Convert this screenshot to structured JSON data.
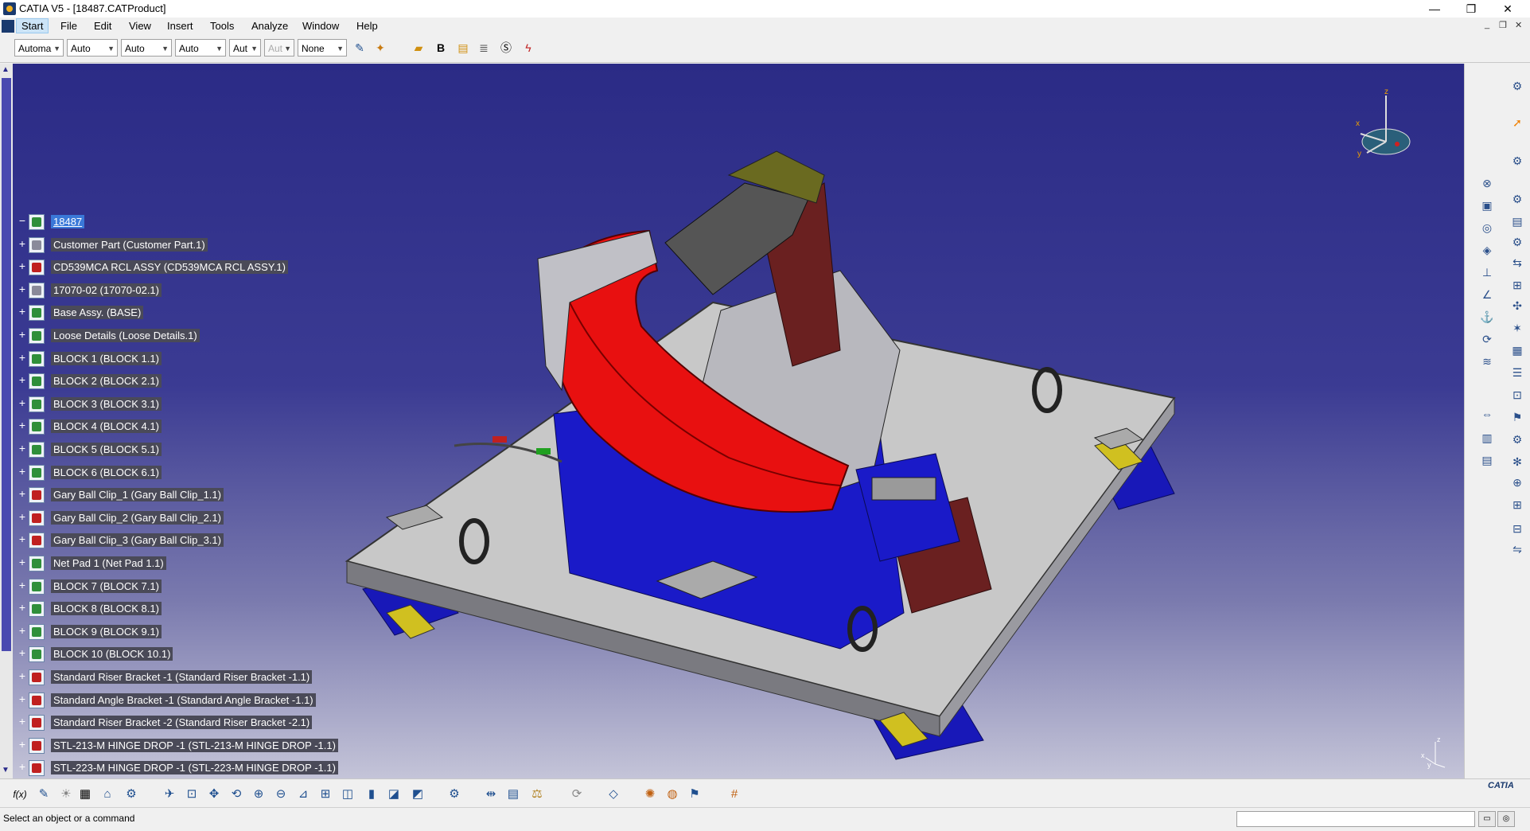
{
  "window": {
    "title": "CATIA V5 - [18487.CATProduct]",
    "minimize": "—",
    "restore": "❐",
    "close": "✕"
  },
  "menu": {
    "items": [
      "Start",
      "File",
      "Edit",
      "View",
      "Insert",
      "Tools",
      "Analyze",
      "Window",
      "Help"
    ],
    "mdi_min": "_",
    "mdi_restore": "❐",
    "mdi_close": "✕"
  },
  "toolbar": {
    "combos": [
      "Automa",
      "Auto",
      "Auto",
      "Auto",
      "Aut",
      "Aut",
      "None"
    ],
    "bold_label": "B"
  },
  "tree": {
    "root": "18487",
    "items": [
      {
        "label": "Customer Part (Customer Part.1)",
        "icon": "gray"
      },
      {
        "label": "CD539MCA RCL ASSY (CD539MCA RCL ASSY.1)",
        "icon": "red"
      },
      {
        "label": "17070-02 (17070-02.1)",
        "icon": "gray"
      },
      {
        "label": "Base Assy. (BASE)",
        "icon": "green"
      },
      {
        "label": "Loose Details (Loose Details.1)",
        "icon": "green"
      },
      {
        "label": "BLOCK 1 (BLOCK 1.1)",
        "icon": "green"
      },
      {
        "label": "BLOCK 2 (BLOCK 2.1)",
        "icon": "green"
      },
      {
        "label": "BLOCK 3 (BLOCK 3.1)",
        "icon": "green"
      },
      {
        "label": "BLOCK 4 (BLOCK 4.1)",
        "icon": "green"
      },
      {
        "label": "BLOCK 5 (BLOCK 5.1)",
        "icon": "green"
      },
      {
        "label": "BLOCK 6 (BLOCK 6.1)",
        "icon": "green"
      },
      {
        "label": "Gary Ball Clip_1 (Gary Ball Clip_1.1)",
        "icon": "red"
      },
      {
        "label": "Gary Ball Clip_2 (Gary Ball Clip_2.1)",
        "icon": "red"
      },
      {
        "label": "Gary Ball Clip_3 (Gary Ball Clip_3.1)",
        "icon": "red"
      },
      {
        "label": "Net Pad 1 (Net Pad 1.1)",
        "icon": "green"
      },
      {
        "label": "BLOCK 7 (BLOCK 7.1)",
        "icon": "green"
      },
      {
        "label": "BLOCK 8 (BLOCK 8.1)",
        "icon": "green"
      },
      {
        "label": "BLOCK 9 (BLOCK 9.1)",
        "icon": "green"
      },
      {
        "label": "BLOCK 10 (BLOCK 10.1)",
        "icon": "green"
      },
      {
        "label": "Standard Riser Bracket -1 (Standard Riser Bracket -1.1)",
        "icon": "red"
      },
      {
        "label": "Standard Angle Bracket -1 (Standard Angle Bracket -1.1)",
        "icon": "red"
      },
      {
        "label": "Standard Riser Bracket -2 (Standard Riser Bracket -2.1)",
        "icon": "red"
      },
      {
        "label": "STL-213-M HINGE DROP -1 (STL-213-M HINGE DROP -1.1)",
        "icon": "red"
      },
      {
        "label": "STL-223-M HINGE DROP -1 (STL-223-M HINGE DROP -1.1)",
        "icon": "red"
      }
    ]
  },
  "compass": {
    "x_label": "x",
    "y_label": "y",
    "z_label": "z"
  },
  "mini_axis": {
    "x_label": "x",
    "y_label": "y",
    "z_label": "z"
  },
  "bottom": {
    "formula_label": "f(x)",
    "logo_text": "CATIA"
  },
  "status": {
    "message": "Select an object or a command"
  },
  "colors": {
    "part_red": "#e81010",
    "fixture_blue": "#1010c8",
    "plate_gray": "#c8c8c8",
    "bracket_yellow": "#d0c020"
  }
}
